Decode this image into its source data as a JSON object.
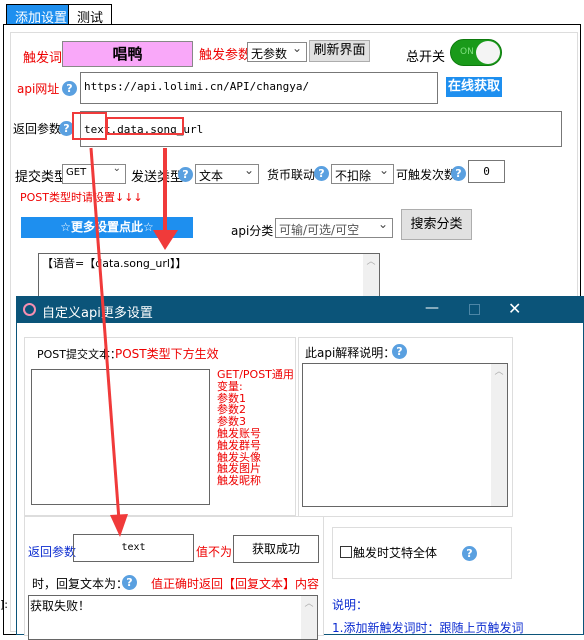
{
  "tabs": [
    "添加设置",
    "测试"
  ],
  "trigger": {
    "label": "触发词",
    "value": "唱鸭",
    "param_label": "触发参数",
    "param_value": "无参数",
    "refresh": "刷新界面",
    "switch_label": "总开关",
    "switch_state": "ON"
  },
  "api": {
    "label": "api网址",
    "url": "https://api.lolimi.cn/API/changya/",
    "online": "在线获取"
  },
  "return_params": {
    "label": "返回参数",
    "value": "text,data.song_url"
  },
  "row": {
    "submit_label": "提交类型",
    "submit_value": "GET",
    "send_label": "发送类型",
    "send_value": "文本",
    "currency_label": "货币联动",
    "currency_value": "不扣除",
    "count_label": "可触发次数",
    "count_value": "0"
  },
  "post_hint": "POST类型时请设置↓↓↓",
  "more_settings": "☆更多设置点此☆",
  "category": {
    "label": "api分类",
    "value": "可输/可选/可空",
    "search": "搜索分类"
  },
  "reply_text": "【语音=【data.song_url】】",
  "status_fragment": "]: ",
  "dialog": {
    "title": "自定义api更多设置",
    "post_label": "POST提交文本：",
    "post_hint": "POST类型下方生效",
    "variables": [
      "GET/POST通用",
      "变量:",
      "参数1",
      "参数2",
      "参数3",
      "触发账号",
      "触发群号",
      "触发头像",
      "触发图片",
      "触发昵称"
    ],
    "explain_label": "此api解释说明：",
    "return_label": "返回参数",
    "return_value": "text",
    "not_label": "值不为",
    "not_value": "获取成功",
    "reply_label": "时，回复文本为：",
    "reply_hint": "值正确时返回【回复文本】内容",
    "reply_value": "获取失败！",
    "at_all": "触发时艾特全体",
    "note_title": "说明：",
    "note_line": "1.添加新触发词时：跟随上页触发词"
  },
  "colors": {
    "accent": "#1e8fef",
    "titlebar": "#0b5479",
    "trigger_bg": "#f9a8f9",
    "annotation": "#f03a3a"
  }
}
